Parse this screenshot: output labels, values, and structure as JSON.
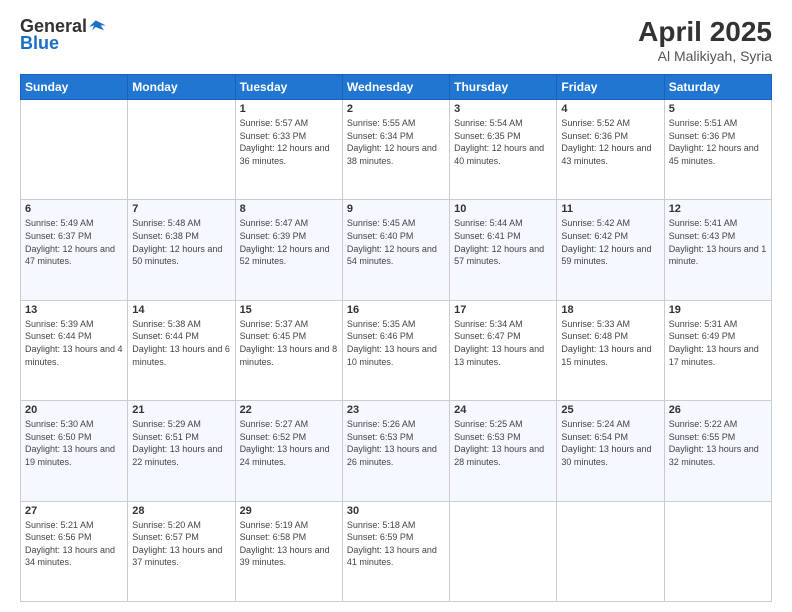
{
  "logo": {
    "general": "General",
    "blue": "Blue"
  },
  "title": "April 2025",
  "subtitle": "Al Malikiyah, Syria",
  "days_of_week": [
    "Sunday",
    "Monday",
    "Tuesday",
    "Wednesday",
    "Thursday",
    "Friday",
    "Saturday"
  ],
  "weeks": [
    [
      {
        "day": "",
        "sunrise": "",
        "sunset": "",
        "daylight": ""
      },
      {
        "day": "",
        "sunrise": "",
        "sunset": "",
        "daylight": ""
      },
      {
        "day": "1",
        "sunrise": "Sunrise: 5:57 AM",
        "sunset": "Sunset: 6:33 PM",
        "daylight": "Daylight: 12 hours and 36 minutes."
      },
      {
        "day": "2",
        "sunrise": "Sunrise: 5:55 AM",
        "sunset": "Sunset: 6:34 PM",
        "daylight": "Daylight: 12 hours and 38 minutes."
      },
      {
        "day": "3",
        "sunrise": "Sunrise: 5:54 AM",
        "sunset": "Sunset: 6:35 PM",
        "daylight": "Daylight: 12 hours and 40 minutes."
      },
      {
        "day": "4",
        "sunrise": "Sunrise: 5:52 AM",
        "sunset": "Sunset: 6:36 PM",
        "daylight": "Daylight: 12 hours and 43 minutes."
      },
      {
        "day": "5",
        "sunrise": "Sunrise: 5:51 AM",
        "sunset": "Sunset: 6:36 PM",
        "daylight": "Daylight: 12 hours and 45 minutes."
      }
    ],
    [
      {
        "day": "6",
        "sunrise": "Sunrise: 5:49 AM",
        "sunset": "Sunset: 6:37 PM",
        "daylight": "Daylight: 12 hours and 47 minutes."
      },
      {
        "day": "7",
        "sunrise": "Sunrise: 5:48 AM",
        "sunset": "Sunset: 6:38 PM",
        "daylight": "Daylight: 12 hours and 50 minutes."
      },
      {
        "day": "8",
        "sunrise": "Sunrise: 5:47 AM",
        "sunset": "Sunset: 6:39 PM",
        "daylight": "Daylight: 12 hours and 52 minutes."
      },
      {
        "day": "9",
        "sunrise": "Sunrise: 5:45 AM",
        "sunset": "Sunset: 6:40 PM",
        "daylight": "Daylight: 12 hours and 54 minutes."
      },
      {
        "day": "10",
        "sunrise": "Sunrise: 5:44 AM",
        "sunset": "Sunset: 6:41 PM",
        "daylight": "Daylight: 12 hours and 57 minutes."
      },
      {
        "day": "11",
        "sunrise": "Sunrise: 5:42 AM",
        "sunset": "Sunset: 6:42 PM",
        "daylight": "Daylight: 12 hours and 59 minutes."
      },
      {
        "day": "12",
        "sunrise": "Sunrise: 5:41 AM",
        "sunset": "Sunset: 6:43 PM",
        "daylight": "Daylight: 13 hours and 1 minute."
      }
    ],
    [
      {
        "day": "13",
        "sunrise": "Sunrise: 5:39 AM",
        "sunset": "Sunset: 6:44 PM",
        "daylight": "Daylight: 13 hours and 4 minutes."
      },
      {
        "day": "14",
        "sunrise": "Sunrise: 5:38 AM",
        "sunset": "Sunset: 6:44 PM",
        "daylight": "Daylight: 13 hours and 6 minutes."
      },
      {
        "day": "15",
        "sunrise": "Sunrise: 5:37 AM",
        "sunset": "Sunset: 6:45 PM",
        "daylight": "Daylight: 13 hours and 8 minutes."
      },
      {
        "day": "16",
        "sunrise": "Sunrise: 5:35 AM",
        "sunset": "Sunset: 6:46 PM",
        "daylight": "Daylight: 13 hours and 10 minutes."
      },
      {
        "day": "17",
        "sunrise": "Sunrise: 5:34 AM",
        "sunset": "Sunset: 6:47 PM",
        "daylight": "Daylight: 13 hours and 13 minutes."
      },
      {
        "day": "18",
        "sunrise": "Sunrise: 5:33 AM",
        "sunset": "Sunset: 6:48 PM",
        "daylight": "Daylight: 13 hours and 15 minutes."
      },
      {
        "day": "19",
        "sunrise": "Sunrise: 5:31 AM",
        "sunset": "Sunset: 6:49 PM",
        "daylight": "Daylight: 13 hours and 17 minutes."
      }
    ],
    [
      {
        "day": "20",
        "sunrise": "Sunrise: 5:30 AM",
        "sunset": "Sunset: 6:50 PM",
        "daylight": "Daylight: 13 hours and 19 minutes."
      },
      {
        "day": "21",
        "sunrise": "Sunrise: 5:29 AM",
        "sunset": "Sunset: 6:51 PM",
        "daylight": "Daylight: 13 hours and 22 minutes."
      },
      {
        "day": "22",
        "sunrise": "Sunrise: 5:27 AM",
        "sunset": "Sunset: 6:52 PM",
        "daylight": "Daylight: 13 hours and 24 minutes."
      },
      {
        "day": "23",
        "sunrise": "Sunrise: 5:26 AM",
        "sunset": "Sunset: 6:53 PM",
        "daylight": "Daylight: 13 hours and 26 minutes."
      },
      {
        "day": "24",
        "sunrise": "Sunrise: 5:25 AM",
        "sunset": "Sunset: 6:53 PM",
        "daylight": "Daylight: 13 hours and 28 minutes."
      },
      {
        "day": "25",
        "sunrise": "Sunrise: 5:24 AM",
        "sunset": "Sunset: 6:54 PM",
        "daylight": "Daylight: 13 hours and 30 minutes."
      },
      {
        "day": "26",
        "sunrise": "Sunrise: 5:22 AM",
        "sunset": "Sunset: 6:55 PM",
        "daylight": "Daylight: 13 hours and 32 minutes."
      }
    ],
    [
      {
        "day": "27",
        "sunrise": "Sunrise: 5:21 AM",
        "sunset": "Sunset: 6:56 PM",
        "daylight": "Daylight: 13 hours and 34 minutes."
      },
      {
        "day": "28",
        "sunrise": "Sunrise: 5:20 AM",
        "sunset": "Sunset: 6:57 PM",
        "daylight": "Daylight: 13 hours and 37 minutes."
      },
      {
        "day": "29",
        "sunrise": "Sunrise: 5:19 AM",
        "sunset": "Sunset: 6:58 PM",
        "daylight": "Daylight: 13 hours and 39 minutes."
      },
      {
        "day": "30",
        "sunrise": "Sunrise: 5:18 AM",
        "sunset": "Sunset: 6:59 PM",
        "daylight": "Daylight: 13 hours and 41 minutes."
      },
      {
        "day": "",
        "sunrise": "",
        "sunset": "",
        "daylight": ""
      },
      {
        "day": "",
        "sunrise": "",
        "sunset": "",
        "daylight": ""
      },
      {
        "day": "",
        "sunrise": "",
        "sunset": "",
        "daylight": ""
      }
    ]
  ]
}
